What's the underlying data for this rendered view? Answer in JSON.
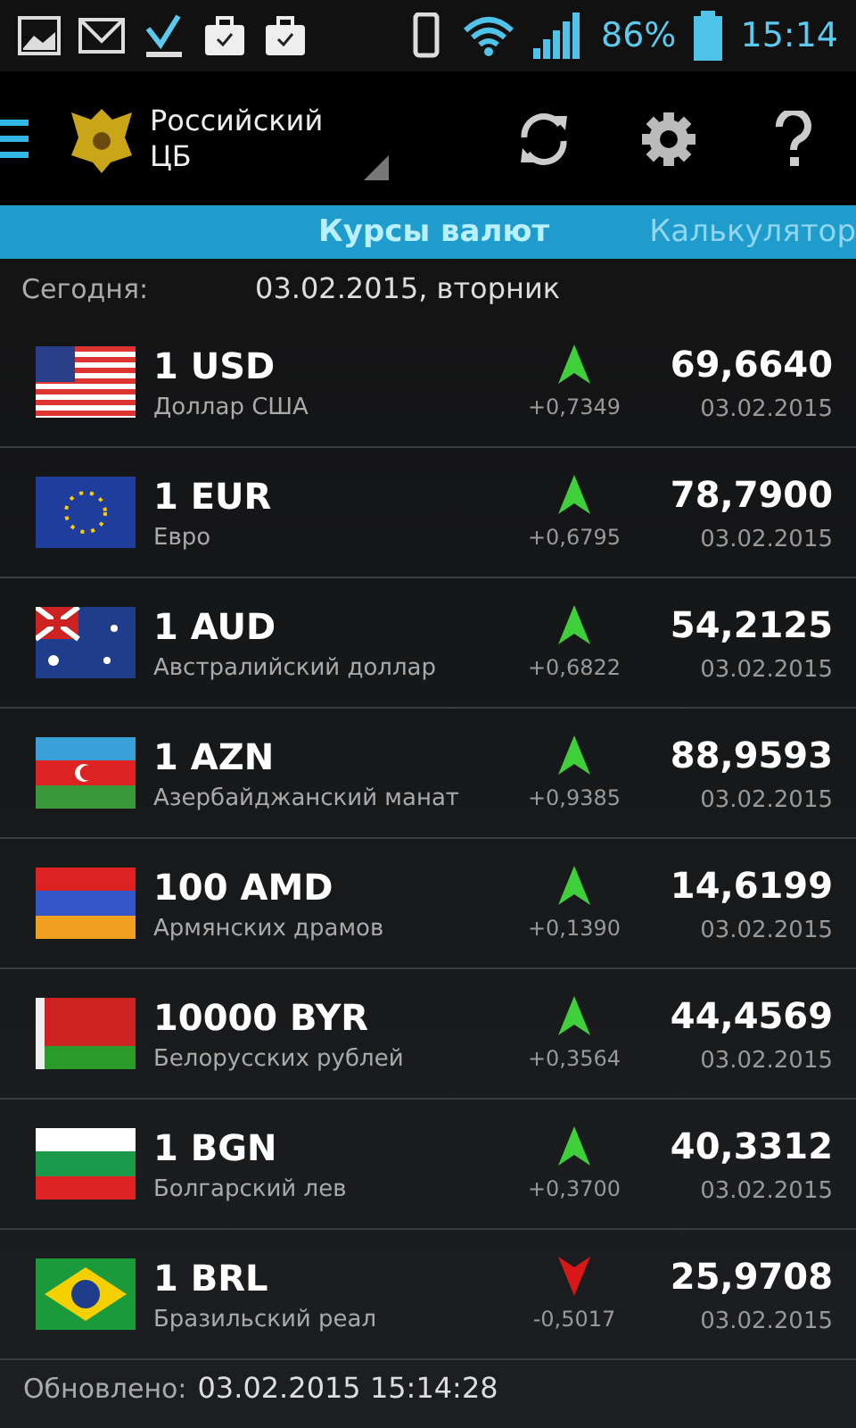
{
  "status_bar": {
    "battery": "86%",
    "time": "15:14"
  },
  "toolbar": {
    "title": "Российский ЦБ"
  },
  "tabs": [
    {
      "label": "Курсы валют",
      "selected": true
    },
    {
      "label": "Калькулятор",
      "selected": false
    }
  ],
  "today": {
    "label": "Сегодня:",
    "value": "03.02.2015, вторник"
  },
  "rates": [
    {
      "code": "1 USD",
      "name": "Доллар США",
      "rising": true,
      "change": "+0,7349",
      "rate": "69,6640",
      "date": "03.02.2015"
    },
    {
      "code": "1 EUR",
      "name": "Евро",
      "rising": true,
      "change": "+0,6795",
      "rate": "78,7900",
      "date": "03.02.2015"
    },
    {
      "code": "1 AUD",
      "name": "Австралийский доллар",
      "rising": true,
      "change": "+0,6822",
      "rate": "54,2125",
      "date": "03.02.2015"
    },
    {
      "code": "1 AZN",
      "name": "Азербайджанский манат",
      "rising": true,
      "change": "+0,9385",
      "rate": "88,9593",
      "date": "03.02.2015"
    },
    {
      "code": "100 AMD",
      "name": "Армянских драмов",
      "rising": true,
      "change": "+0,1390",
      "rate": "14,6199",
      "date": "03.02.2015"
    },
    {
      "code": "10000 BYR",
      "name": "Белорусских рублей",
      "rising": true,
      "change": "+0,3564",
      "rate": "44,4569",
      "date": "03.02.2015"
    },
    {
      "code": "1 BGN",
      "name": "Болгарский лев",
      "rising": true,
      "change": "+0,3700",
      "rate": "40,3312",
      "date": "03.02.2015"
    },
    {
      "code": "1 BRL",
      "name": "Бразильский реал",
      "rising": false,
      "change": "-0,5017",
      "rate": "25,9708",
      "date": "03.02.2015"
    }
  ],
  "footer": {
    "label": "Обновлено:",
    "value": "03.02.2015 15:14:28"
  }
}
